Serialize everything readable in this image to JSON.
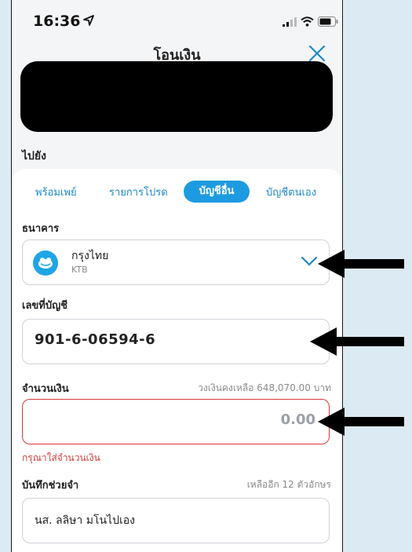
{
  "status_bar": {
    "time": "16:36",
    "location_icon": "location-arrow-icon",
    "signal_icon": "cellular-signal-icon",
    "wifi_icon": "wifi-icon",
    "battery_icon": "battery-icon"
  },
  "header": {
    "title": "โอนเงิน",
    "close_icon": "close-icon"
  },
  "to_section": {
    "label": "ไปยัง"
  },
  "tabs": [
    {
      "label": "พร้อมเพย์",
      "active": false
    },
    {
      "label": "รายการโปรด",
      "active": false
    },
    {
      "label": "บัญชีอื่น",
      "active": true
    },
    {
      "label": "บัญชีตนเอง",
      "active": false
    }
  ],
  "bank": {
    "label": "ธนาคาร",
    "name": "กรุงไทย",
    "code": "KTB",
    "logo_icon": "krungthai-bank-logo-icon",
    "dropdown_icon": "chevron-down-icon"
  },
  "account": {
    "label": "เลขที่บัญชี",
    "value": "901-6-06594-6"
  },
  "amount": {
    "label": "จำนวนเงิน",
    "limit_text": "วงเงินคงเหลือ 648,070.00 บาท",
    "value": "0.00",
    "error": "กรุณาใส่จำนวนเงิน"
  },
  "memo": {
    "label": "บันทึกช่วยจำ",
    "remaining_text": "เหลืออีก 12 ตัวอักษร",
    "value": "นส. ลลิษา มโนไปเอง"
  },
  "colors": {
    "accent": "#1e9be0",
    "error": "#d63b3b",
    "redaction": "#000000",
    "outer_background": "#dbeaf3"
  }
}
